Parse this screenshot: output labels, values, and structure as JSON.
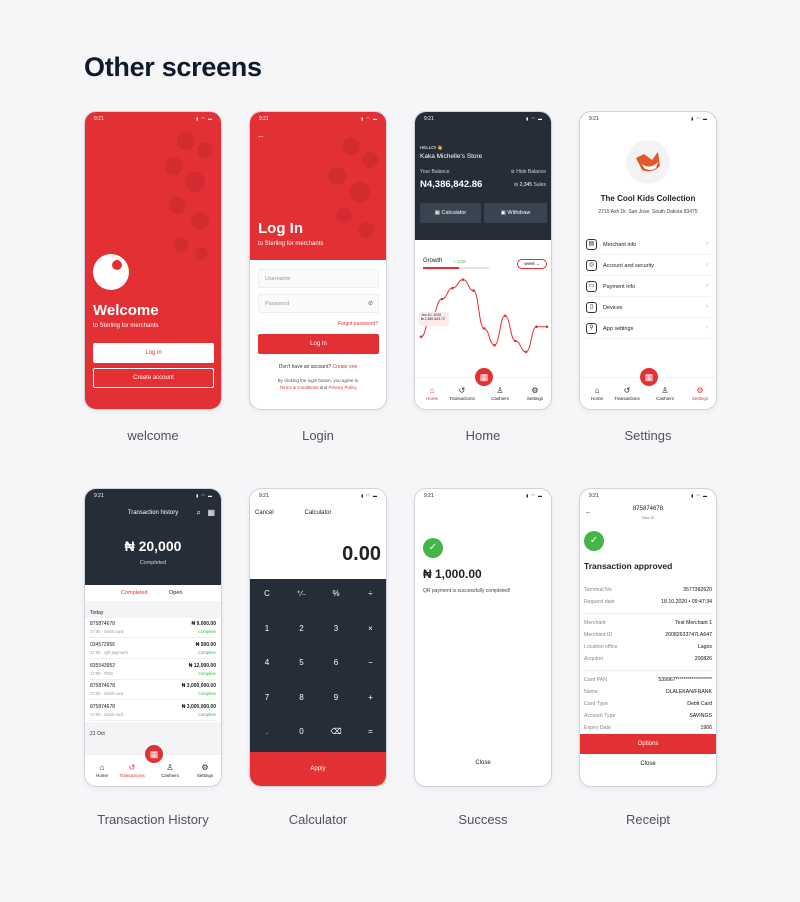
{
  "page": {
    "title": "Other screens"
  },
  "status_time": "9:21",
  "status_icons": "▮ ◠ ▬",
  "captions": {
    "welcome": "welcome",
    "login": "Login",
    "home": "Home",
    "settings": "Settings",
    "history": "Transaction History",
    "calculator": "Calculator",
    "success": "Success",
    "receipt": "Receipt"
  },
  "colors": {
    "accent": "#e23035",
    "dark": "#252d38",
    "success": "#43b649"
  },
  "welcome": {
    "title": "Welcome",
    "subtitle": "to Sterling for merchants",
    "login": "Log in",
    "create": "Create account"
  },
  "login": {
    "back": "←",
    "title": "Log In",
    "subtitle": "to Sterling for merchants",
    "username_placeholder": "Username",
    "password_placeholder": "Password",
    "forgot": "Forgot password?",
    "button": "Log In",
    "no_account": "Don't have an account?",
    "create_one": "Create one",
    "terms_pre": "By clicking the login button, you agree to",
    "terms": "Terms & Conditions",
    "and": "and",
    "privacy": "Privacy Policy"
  },
  "home": {
    "hello": "HELLO! 👋",
    "store": "Kaka Michelle's Store",
    "balance_label": "Your Balance",
    "hide": "Hide Balance",
    "balance": "N4,386,842.86",
    "sales": "2,345",
    "sales_label": "Sales",
    "calculator": "Calculator",
    "withdraw": "Withdraw",
    "growth": "Growth",
    "growth_pct": "+ 12%",
    "period": "week",
    "tooltip_date": "Jan 10, 2020",
    "tooltip_value": "₦ 1,380,543.72"
  },
  "chart_data": {
    "type": "line",
    "series": [
      {
        "values": [
          30,
          55,
          75,
          88,
          98,
          85,
          40,
          20,
          55,
          25,
          12,
          42,
          42
        ]
      }
    ],
    "ylim": [
      0,
      100
    ]
  },
  "tabs": {
    "home": "Home",
    "transactions": "Transactions",
    "cashiers": "Cashiers",
    "settings": "Settings"
  },
  "tab_icons": {
    "home": "⌂",
    "transactions": "↺",
    "cashiers": "♙",
    "settings": "⚙",
    "center": "▦"
  },
  "settings": {
    "store": "The Cool Kids Collection",
    "address": "2715 Ash Dr. San Jose, South Dakota 83475",
    "items": [
      {
        "label": "Merchant info",
        "icon": "▤"
      },
      {
        "label": "Account and security",
        "icon": "◎"
      },
      {
        "label": "Payment info",
        "icon": "▭"
      },
      {
        "label": "Devices",
        "icon": "▯"
      },
      {
        "label": "App settings",
        "icon": "⚲"
      }
    ]
  },
  "history": {
    "title": "Transaction history",
    "amount": "₦ 20,000",
    "status": "Completed",
    "tab_completed": "Completed",
    "tab_open": "Open",
    "today": "Today",
    "oct": "21 Oct",
    "rows": [
      {
        "id": "875874678",
        "sub": "17:00 - Debit card",
        "amount": "₦ 9,000.00",
        "status": "Complete"
      },
      {
        "id": "034572956",
        "sub": "17:00 - QR payment",
        "amount": "₦ 500.00",
        "status": "Complete"
      },
      {
        "id": "835543952",
        "sub": "17:00 - POS",
        "amount": "₦ 12,000.00",
        "status": "Complete"
      },
      {
        "id": "875874678",
        "sub": "17:00 - Debit card",
        "amount": "₦ 3,000,000.00",
        "status": "Complete"
      },
      {
        "id": "875874678",
        "sub": "17:00 - Debit card",
        "amount": "₦ 3,000,000.00",
        "status": "Complete"
      }
    ]
  },
  "calculator": {
    "cancel": "Cancel",
    "title": "Calculator",
    "display": "0.00",
    "keys": [
      "C",
      "⁺∕₋",
      "%",
      "÷",
      "1",
      "2",
      "3",
      "×",
      "4",
      "5",
      "6",
      "−",
      "7",
      "8",
      "9",
      "+",
      ".",
      "0",
      "⌫",
      "="
    ],
    "apply": "Apply"
  },
  "success": {
    "amount": "₦ 1,000.00",
    "message": "QR payment is successfully completed!",
    "close": "Close"
  },
  "receipt": {
    "id": "875874678",
    "sale": "Sale ID",
    "title": "Transaction approved",
    "rows1": [
      {
        "l": "Terminal No",
        "v": "3577362620"
      },
      {
        "l": "Request date",
        "v": "18.10.2020 • 09:47:34"
      }
    ],
    "rows2": [
      {
        "l": "Merchant",
        "v": "Test  Merchant 1"
      },
      {
        "l": "Merchant ID",
        "v": "20082633747LA647"
      },
      {
        "l": "Location office",
        "v": "Lagos"
      },
      {
        "l": "Acquirer",
        "v": "200826"
      }
    ],
    "rows3": [
      {
        "l": "Card PAN",
        "v": "539967******************"
      },
      {
        "l": "Name",
        "v": "OLALEKAN/FRANK"
      },
      {
        "l": "Card Type",
        "v": "Debit Card"
      },
      {
        "l": "Account Type",
        "v": "SAVINGS"
      },
      {
        "l": "Expiry Date",
        "v": "1906"
      }
    ],
    "options": "Options",
    "close": "Close"
  }
}
